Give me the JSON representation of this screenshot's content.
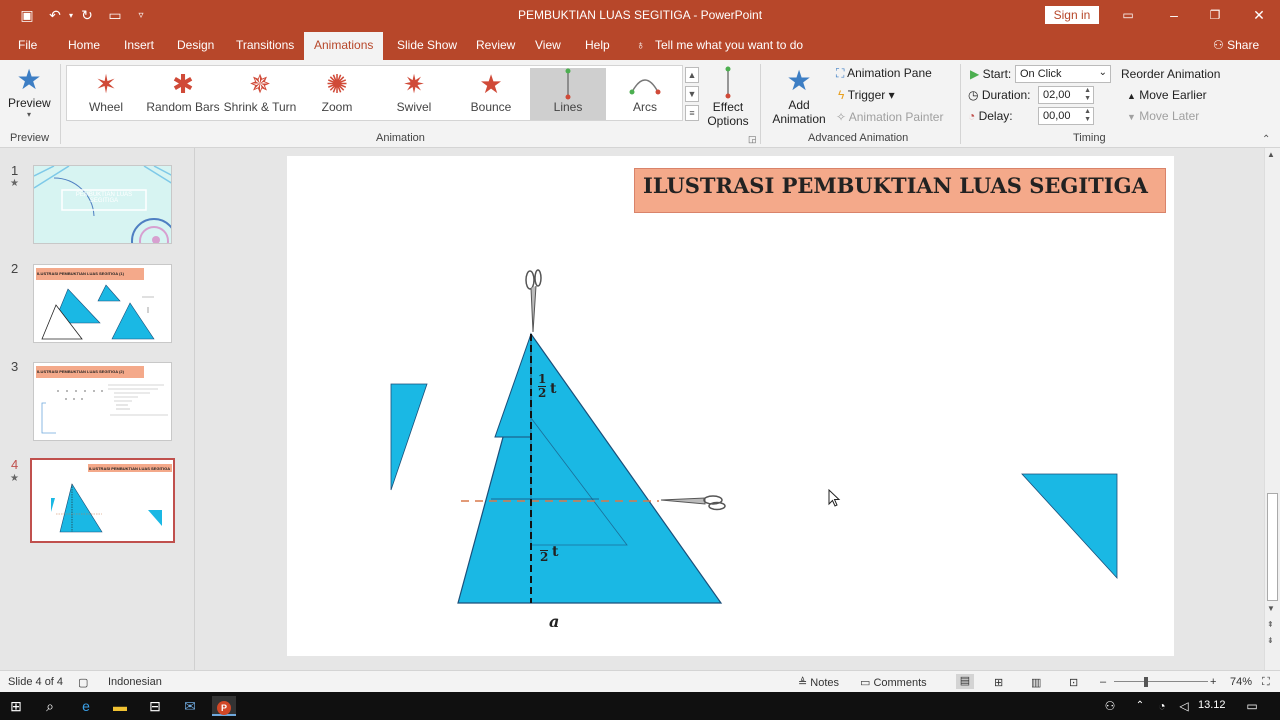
{
  "app": {
    "title": "PEMBUKTIAN LUAS SEGITIGA  -  PowerPoint",
    "sign_in": "Sign in"
  },
  "tabs": [
    "File",
    "Home",
    "Insert",
    "Design",
    "Transitions",
    "Animations",
    "Slide Show",
    "Review",
    "View",
    "Help"
  ],
  "active_tab": "Animations",
  "tell_me": "Tell me what you want to do",
  "share": "Share",
  "ribbon": {
    "preview_label": "Preview",
    "preview_group": "Preview",
    "animations": [
      {
        "label": "Wheel",
        "icon": "wheel-star-icon"
      },
      {
        "label": "Random Bars",
        "icon": "random-bars-star-icon"
      },
      {
        "label": "Shrink & Turn",
        "icon": "shrink-turn-star-icon"
      },
      {
        "label": "Zoom",
        "icon": "zoom-star-icon"
      },
      {
        "label": "Swivel",
        "icon": "swivel-star-icon"
      },
      {
        "label": "Bounce",
        "icon": "bounce-star-icon"
      },
      {
        "label": "Lines",
        "icon": "lines-path-icon"
      },
      {
        "label": "Arcs",
        "icon": "arcs-path-icon"
      }
    ],
    "selected_animation": "Lines",
    "effect_options": "Effect Options",
    "animation_group": "Animation",
    "add_animation": "Add Animation",
    "animation_pane": "Animation Pane",
    "trigger": "Trigger",
    "animation_painter": "Animation Painter",
    "advanced_group": "Advanced Animation",
    "start_label": "Start:",
    "start_value": "On Click",
    "duration_label": "Duration:",
    "duration_value": "02,00",
    "delay_label": "Delay:",
    "delay_value": "00,00",
    "reorder": "Reorder Animation",
    "move_earlier": "Move Earlier",
    "move_later": "Move Later",
    "timing_group": "Timing"
  },
  "slides": [
    {
      "num": "1",
      "star": "★",
      "title": "PEMBUKTIAN LUAS SEGITIGA"
    },
    {
      "num": "2",
      "star": "",
      "title": "ILUSTRASI PEMBUKTIAN LUAS SEGITIGA (1)"
    },
    {
      "num": "3",
      "star": "",
      "title": "ILUSTRASI PEMBUKTIAN LUAS SEGITIGA (2)"
    },
    {
      "num": "4",
      "star": "★",
      "title": "ILUSTRASI PEMBUKTIAN LUAS SEGITIGA"
    }
  ],
  "current_slide": {
    "title": "ILUSTRASI PEMBUKTIAN LUAS SEGITIGA",
    "half_num": "1",
    "half_den": "2",
    "t": "t",
    "base_label": "a",
    "colors": {
      "shape": "#1ab8e4",
      "title_bg": "#f4a98a"
    }
  },
  "status": {
    "slide": "Slide 4 of 4",
    "language": "Indonesian",
    "notes": "Notes",
    "comments": "Comments",
    "zoom": "74%"
  },
  "taskbar": {
    "time": "13.12"
  }
}
